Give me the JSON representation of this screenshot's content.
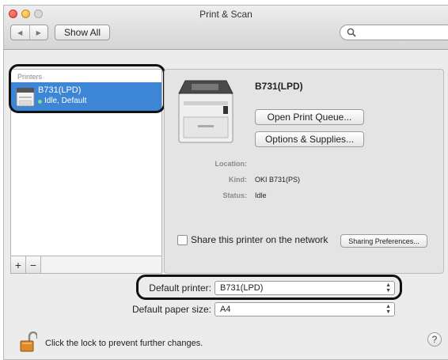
{
  "window": {
    "title": "Print & Scan"
  },
  "toolbar": {
    "back_glyph": "◀",
    "forward_glyph": "▶",
    "show_all_label": "Show All",
    "search_placeholder": ""
  },
  "printers": {
    "header": "Printers",
    "items": [
      {
        "name": "B731(LPD)",
        "status": "Idle, Default"
      }
    ],
    "add_label": "+",
    "remove_label": "−"
  },
  "detail": {
    "name": "B731(LPD)",
    "open_queue_label": "Open Print Queue...",
    "options_label": "Options & Supplies...",
    "location_label": "Location:",
    "location_value": "",
    "kind_label": "Kind:",
    "kind_value": "OKI B731(PS)",
    "status_label": "Status:",
    "status_value": "Idle",
    "share_label": "Share this printer on the network",
    "share_checked": false,
    "sharing_prefs_label": "Sharing Preferences..."
  },
  "defaults": {
    "printer_label": "Default printer:",
    "printer_value": "B731(LPD)",
    "paper_label": "Default paper size:",
    "paper_value": "A4"
  },
  "footer": {
    "lock_text": "Click the lock to prevent further changes.",
    "help_label": "?"
  },
  "colors": {
    "selection": "#3d86d6",
    "window_bg": "#ececec"
  }
}
